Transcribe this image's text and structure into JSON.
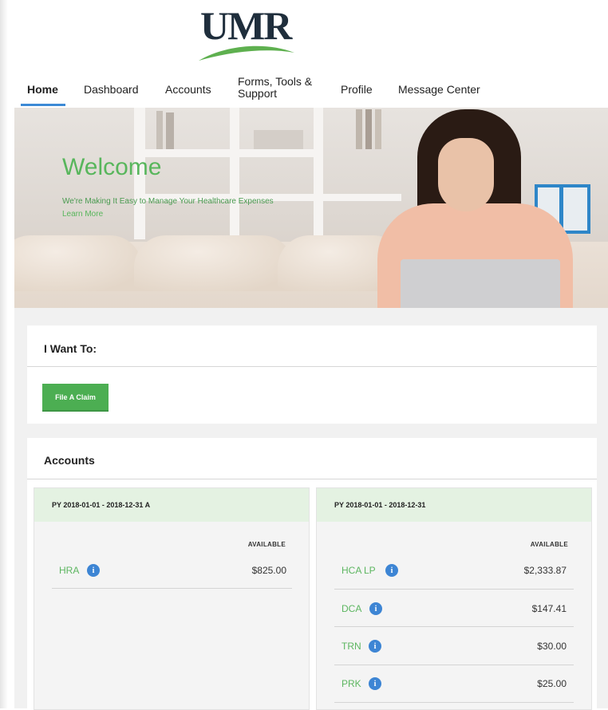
{
  "brand": {
    "logo_text": "UMR",
    "tm": "™"
  },
  "nav": {
    "items": [
      {
        "label": "Home",
        "active": true
      },
      {
        "label": "Dashboard"
      },
      {
        "label": "Accounts"
      },
      {
        "label": "Forms, Tools & Support"
      },
      {
        "label": "Profile"
      },
      {
        "label": "Message Center"
      }
    ],
    "forms_line1": "Forms, Tools &",
    "forms_line2": "Support"
  },
  "hero": {
    "title": "Welcome",
    "subtitle": "We're Making It Easy to Manage Your Healthcare Expenses",
    "link": "Learn More"
  },
  "i_want_to": {
    "title": "I Want To:",
    "file_claim_label": "File A Claim"
  },
  "accounts": {
    "title": "Accounts",
    "available_label": "AVAILABLE",
    "columns": [
      {
        "header": "PY 2018-01-01 - 2018-12-31 A",
        "rows": [
          {
            "name": "HRA",
            "amount": "$825.00"
          }
        ]
      },
      {
        "header": "PY 2018-01-01 - 2018-12-31",
        "rows": [
          {
            "name": "HCA LP",
            "amount": "$2,333.87"
          },
          {
            "name": "DCA",
            "amount": "$147.41"
          },
          {
            "name": "TRN",
            "amount": "$30.00"
          },
          {
            "name": "PRK",
            "amount": "$25.00"
          }
        ]
      }
    ]
  },
  "colors": {
    "brand_green": "#58b65c",
    "nav_underline": "#3d8ad6",
    "info_blue": "#3d85d4",
    "header_tint": "#e4f2e2"
  },
  "icons": {
    "info": "info-icon"
  }
}
